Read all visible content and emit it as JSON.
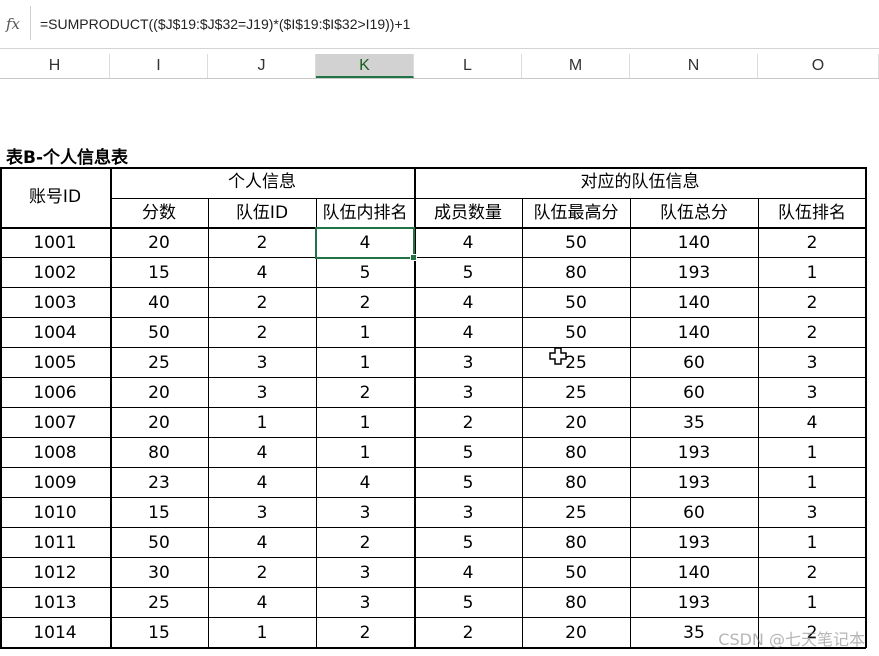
{
  "formula_bar": {
    "fx_label": "fx",
    "formula": "=SUMPRODUCT(($J$19:$J$32=J19)*($I$19:$I$32>I19))+1"
  },
  "column_headers": [
    "H",
    "I",
    "J",
    "K",
    "L",
    "M",
    "N",
    "O"
  ],
  "active_column": "K",
  "table": {
    "title": "表B-个人信息表",
    "account_header": "账号ID",
    "group_personal": "个人信息",
    "group_team": "对应的队伍信息",
    "subheaders": [
      "分数",
      "队伍ID",
      "队伍内排名",
      "成员数量",
      "队伍最高分",
      "队伍总分",
      "队伍排名"
    ],
    "rows": [
      [
        "1001",
        "20",
        "2",
        "4",
        "4",
        "50",
        "140",
        "2"
      ],
      [
        "1002",
        "15",
        "4",
        "5",
        "5",
        "80",
        "193",
        "1"
      ],
      [
        "1003",
        "40",
        "2",
        "2",
        "4",
        "50",
        "140",
        "2"
      ],
      [
        "1004",
        "50",
        "2",
        "1",
        "4",
        "50",
        "140",
        "2"
      ],
      [
        "1005",
        "25",
        "3",
        "1",
        "3",
        "25",
        "60",
        "3"
      ],
      [
        "1006",
        "20",
        "3",
        "2",
        "3",
        "25",
        "60",
        "3"
      ],
      [
        "1007",
        "20",
        "1",
        "1",
        "2",
        "20",
        "35",
        "4"
      ],
      [
        "1008",
        "80",
        "4",
        "1",
        "5",
        "80",
        "193",
        "1"
      ],
      [
        "1009",
        "23",
        "4",
        "4",
        "5",
        "80",
        "193",
        "1"
      ],
      [
        "1010",
        "15",
        "3",
        "3",
        "3",
        "25",
        "60",
        "3"
      ],
      [
        "1011",
        "50",
        "4",
        "2",
        "5",
        "80",
        "193",
        "1"
      ],
      [
        "1012",
        "30",
        "2",
        "3",
        "4",
        "50",
        "140",
        "2"
      ],
      [
        "1013",
        "25",
        "4",
        "3",
        "5",
        "80",
        "193",
        "1"
      ],
      [
        "1014",
        "15",
        "1",
        "2",
        "2",
        "20",
        "35",
        "2"
      ]
    ]
  },
  "watermark": "CSDN @七天笔记本",
  "colors": {
    "selection": "#217346",
    "active_header_bg": "#d2d2d2"
  }
}
